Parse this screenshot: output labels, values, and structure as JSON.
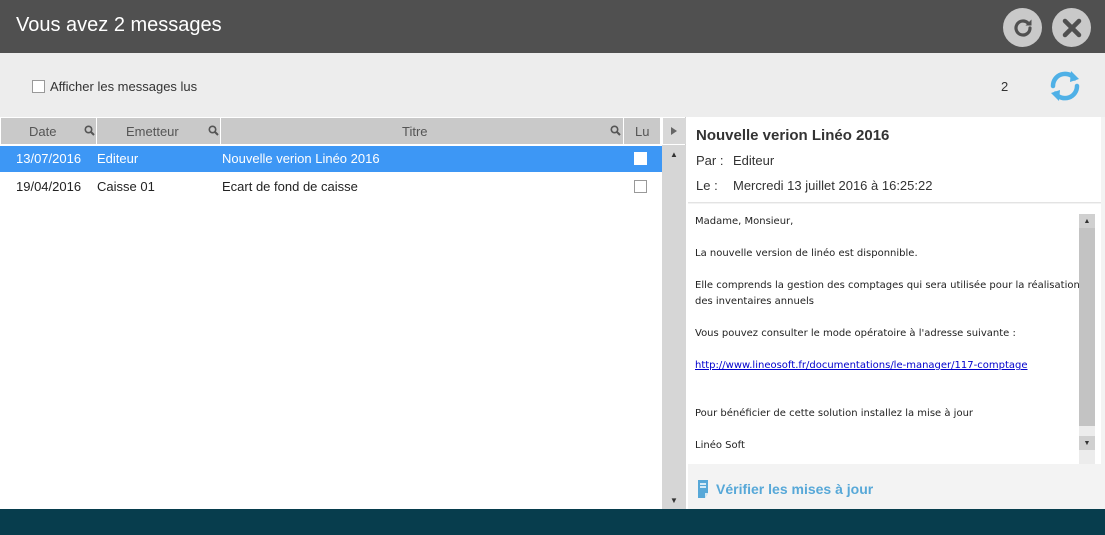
{
  "window": {
    "title": "Vous avez 2 messages",
    "refresh_icon": "refresh-icon",
    "close_icon": "close-icon"
  },
  "toolbar": {
    "show_read_label": "Afficher les messages lus",
    "show_read_checked": false,
    "count": "2",
    "sync_icon": "sync-icon"
  },
  "list": {
    "columns": {
      "date": "Date",
      "emetteur": "Emetteur",
      "titre": "Titre",
      "lu": "Lu"
    },
    "rows": [
      {
        "date": "13/07/2016",
        "emetteur": "Editeur",
        "titre": "Nouvelle verion Linéo 2016",
        "lu": false,
        "selected": true
      },
      {
        "date": "19/04/2016",
        "emetteur": "Caisse 01",
        "titre": "Ecart de fond de caisse",
        "lu": false,
        "selected": false
      }
    ]
  },
  "detail": {
    "subject": "Nouvelle verion Linéo 2016",
    "from_label": "Par :",
    "from_value": "Editeur",
    "date_label": "Le :",
    "date_value": "Mercredi 13 juillet 2016 à 16:25:22",
    "body": {
      "greeting": "Madame, Monsieur,",
      "line1": "La nouvelle version de linéo est disponnible.",
      "line2a": "Elle comprends la gestion des comptages qui sera utilisée pour la réalisation",
      "line2b": "des inventaires annuels",
      "line3": "Vous pouvez consulter le mode opératoire à l'adresse suivante :",
      "link": "http://www.lineosoft.fr/documentations/le-manager/117-comptage",
      "line4": "Pour bénéficier de cette solution installez la mise à jour",
      "signature": "Linéo Soft"
    },
    "update_label": "Vérifier les mises à jour"
  },
  "colors": {
    "titlebar": "#505050",
    "selected_row": "#3d97f5",
    "footer": "#073d4d",
    "accent": "#57a8d8"
  }
}
